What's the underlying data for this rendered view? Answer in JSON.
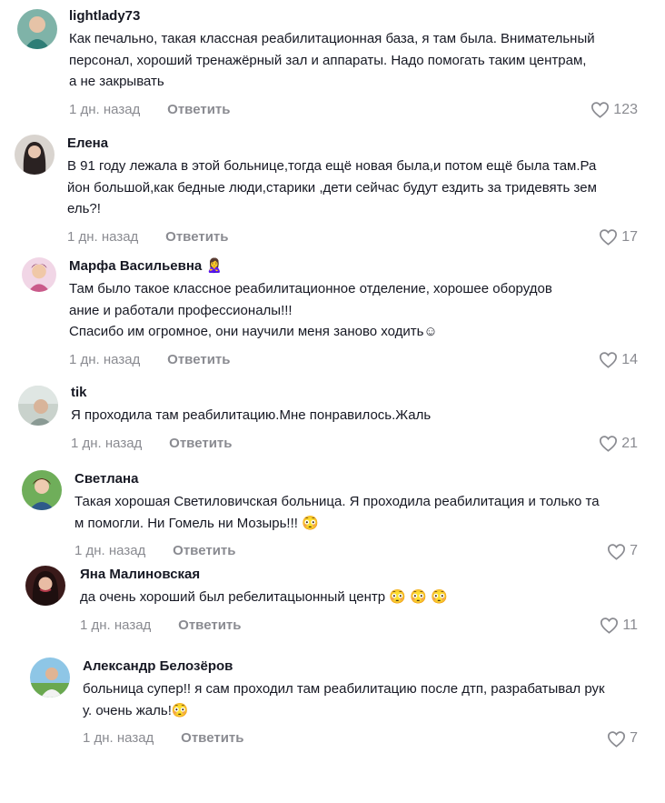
{
  "comments": [
    {
      "author": "lightlady73",
      "text": "Как печально, такая классная реабилитационная база, я там была. Внимательный\nперсонал, хороший тренажёрный зал и аппараты. Надо помогать таким центрам,\nа не закрывать",
      "time": "1 дн. назад",
      "reply": "Ответить",
      "likes": "123",
      "avatar_color": "#3e8f8a"
    },
    {
      "author": "Елена",
      "text": "В 91 году лежала в этой больнице,тогда ещё новая была,и потом ещё была там.Ра\nйон большой,как бедные люди,старики ,дети сейчас будут ездить за тридевять зем\nель?!",
      "time": "1 дн. назад",
      "reply": "Ответить",
      "likes": "17",
      "avatar_color": "#3a3030"
    },
    {
      "author": "Марфа Васильевна 🙎‍♀️",
      "text": "Там было такое классное реабилитационное отделение, хорошее оборудов\nание и работали профессионалы!!!\nСпасибо им огромное, они научили меня заново ходить☺",
      "time": "1 дн. назад",
      "reply": "Ответить",
      "likes": "14",
      "avatar_color": "#c95a8a"
    },
    {
      "author": "tik",
      "text": "Я проходила там реабилитацию.Мне понравилось.Жаль",
      "time": "1 дн. назад",
      "reply": "Ответить",
      "likes": "21",
      "avatar_color": "#9aa6a0"
    },
    {
      "author": "Светлана",
      "text": "Такая хорошая Светиловичская больница. Я проходила реабилитация и только та\nм помогли. Ни Гомель ни Мозырь!!! 😳",
      "time": "1 дн. назад",
      "reply": "Ответить",
      "likes": "7",
      "avatar_color": "#4f8a3c"
    },
    {
      "author": "Яна Малиновская",
      "text": "да очень хороший был ребелитацыонный центр 😳 😳 😳",
      "time": "1 дн. назад",
      "reply": "Ответить",
      "likes": "11",
      "avatar_color": "#5a2a2a"
    },
    {
      "author": "Александр Белозёров",
      "text": "больница супер!! я сам проходил там реабилитацию после дтп, разрабатывал рук\nу. очень жаль!😳",
      "time": "1 дн. назад",
      "reply": "Ответить",
      "likes": "7",
      "avatar_color": "#4a9ac4"
    }
  ]
}
